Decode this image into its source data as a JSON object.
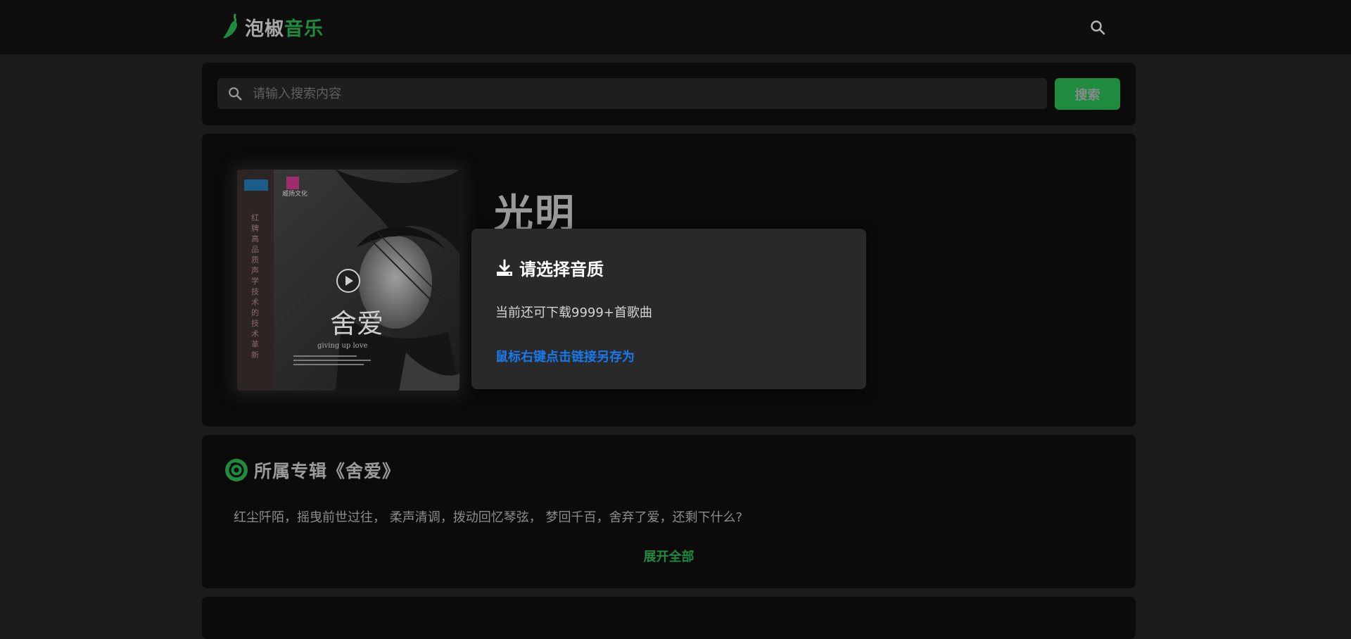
{
  "header": {
    "logo_text_a": "泡椒",
    "logo_text_b": "音乐"
  },
  "search": {
    "placeholder": "请输入搜索内容",
    "button_label": "搜索"
  },
  "song": {
    "title": "光明"
  },
  "album": {
    "heading": "所属专辑《舍爱》",
    "description": "红尘阡陌，摇曳前世过往， 柔声清调，拨动回忆琴弦， 梦回千百，舍弃了爱，还剩下什么?",
    "expand_label": "展开全部",
    "cover_text": {
      "side_vertical": "红牌高品质声学技术的技术革新",
      "label_top": "威扬文化",
      "big_title": "舍爱",
      "subtitle": "giving up love"
    }
  },
  "download_popup": {
    "title": "请选择音质",
    "quota": "当前还可下载9999+首歌曲",
    "link": "鼠标右键点击链接另存为"
  },
  "colors": {
    "accent": "#1e8b3e",
    "link": "#1a78e8",
    "background": "#1b1b1b",
    "panel": "#0b0b0b",
    "popup": "#292929"
  },
  "icons": [
    "pepper-logo-icon",
    "search-icon",
    "play-icon",
    "download-icon",
    "disc-icon"
  ]
}
